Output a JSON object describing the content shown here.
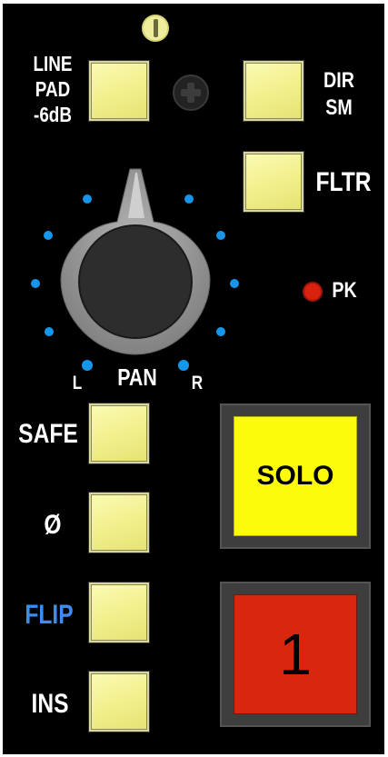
{
  "labels": {
    "line_pad": "LINE\nPAD\n-6dB",
    "dir_sm": "DIR\nSM",
    "fltr": "FLTR",
    "pk": "PK",
    "pan_l": "L",
    "pan": "PAN",
    "pan_r": "R",
    "safe": "SAFE",
    "phase": "Ø",
    "flip": "FLIP",
    "ins": "INS"
  },
  "solo_button": {
    "label": "SOLO"
  },
  "channel_button": {
    "number": "1"
  },
  "colors": {
    "panel": "#000000",
    "button_yellow": "#f1ef8a",
    "solo_yellow": "#fdfb0c",
    "channel_red": "#d8270d",
    "flip_blue": "#3c8cf2",
    "pan_dots": "#1596ea",
    "pk_led": "#d8210e"
  }
}
